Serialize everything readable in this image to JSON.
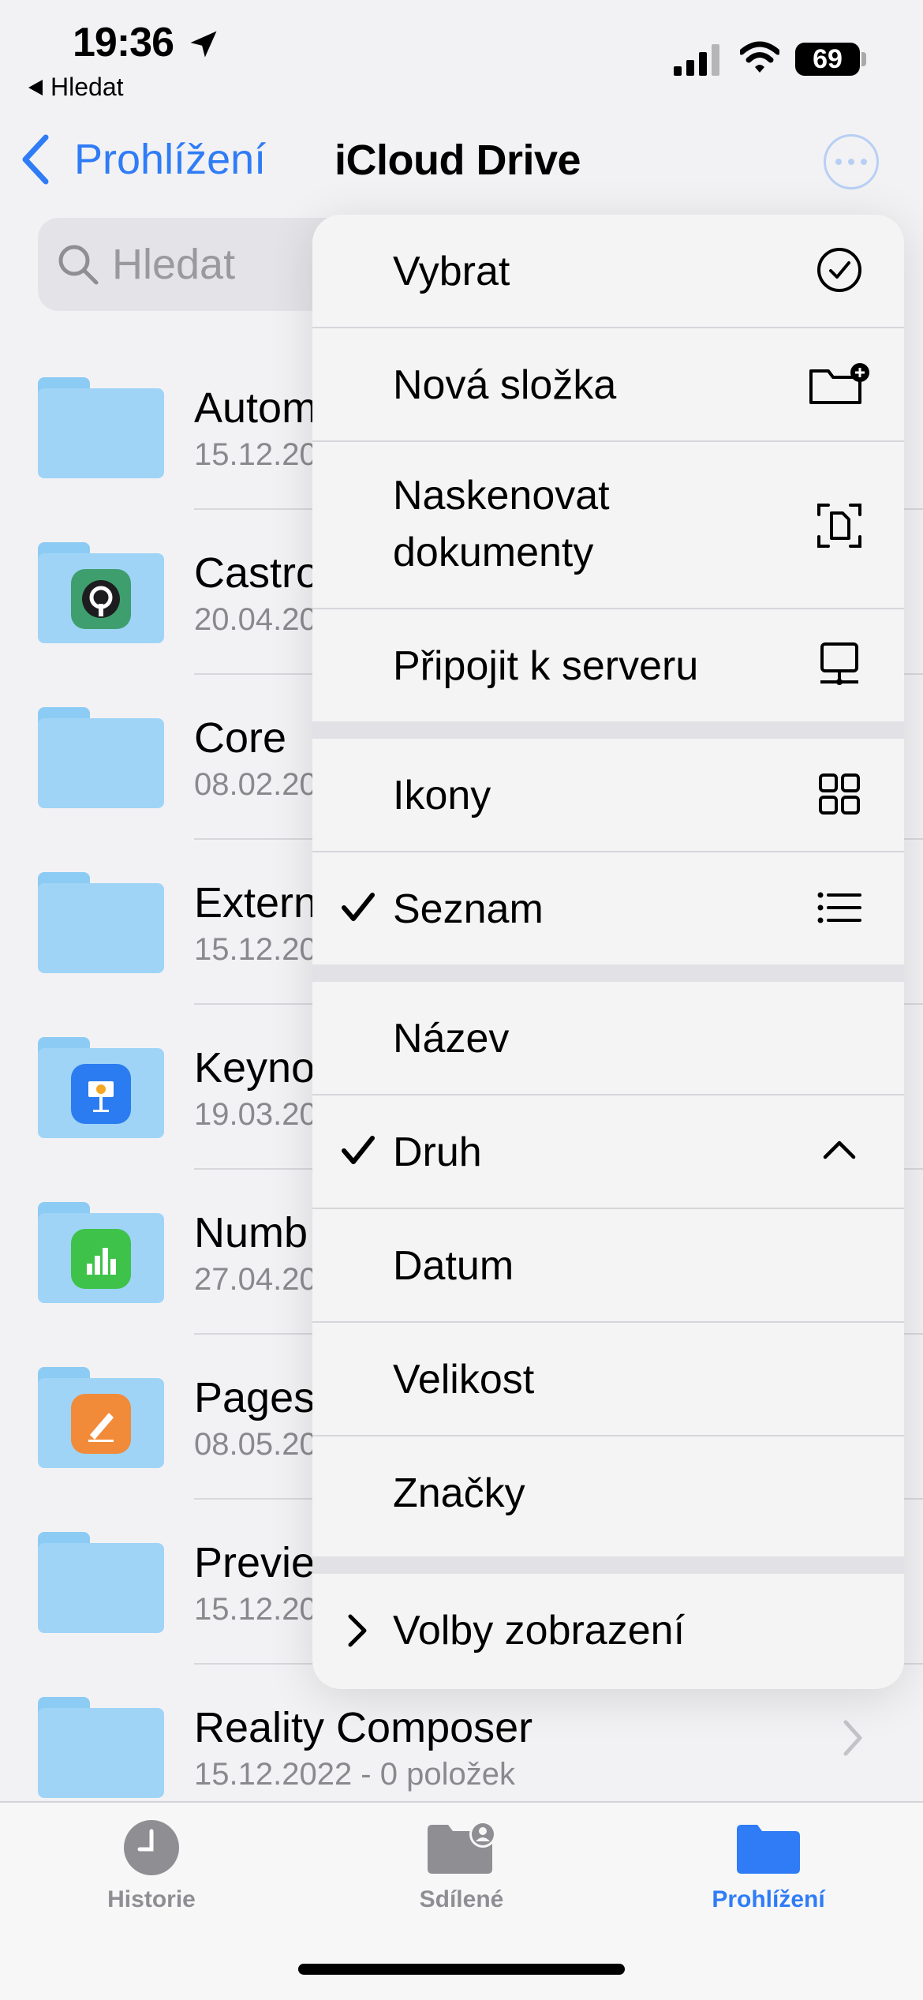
{
  "status_bar": {
    "time": "19:36",
    "back_app_label": "Hledat",
    "battery": "69"
  },
  "nav": {
    "back_label": "Prohlížení",
    "title": "iCloud Drive"
  },
  "search": {
    "placeholder": "Hledat"
  },
  "files": [
    {
      "name": "Autom",
      "date": "15.12.20",
      "badge": ""
    },
    {
      "name": "Castro",
      "date": "20.04.20",
      "badge": "castro"
    },
    {
      "name": "Core",
      "date": "08.02.20",
      "badge": ""
    },
    {
      "name": "Extern",
      "date": "15.12.20",
      "badge": ""
    },
    {
      "name": "Keyno",
      "date": "19.03.20",
      "badge": "keynote"
    },
    {
      "name": "Numb",
      "date": "27.04.20",
      "badge": "numbers"
    },
    {
      "name": "Pages",
      "date": "08.05.20",
      "badge": "pages"
    },
    {
      "name": "Previe",
      "date": "15.12.20",
      "badge": ""
    },
    {
      "name": "Reality Composer",
      "date": "15.12.2022 - 0 položek",
      "badge": ""
    }
  ],
  "menu": {
    "select": "Vybrat",
    "new_folder": "Nová složka",
    "scan_line1": "Naskenovat",
    "scan_line2": "dokumenty",
    "connect_server": "Připojit k serveru",
    "icons": "Ikony",
    "list": "Seznam",
    "sort_name": "Název",
    "sort_kind": "Druh",
    "sort_date": "Datum",
    "sort_size": "Velikost",
    "sort_tags": "Značky",
    "view_options": "Volby zobrazení"
  },
  "tabbar": {
    "history": "Historie",
    "shared": "Sdílené",
    "browse": "Prohlížení"
  },
  "colors": {
    "accent": "#2f7cf6",
    "folder": "#9fd4f7",
    "secondary_text": "#8a8a8e"
  }
}
